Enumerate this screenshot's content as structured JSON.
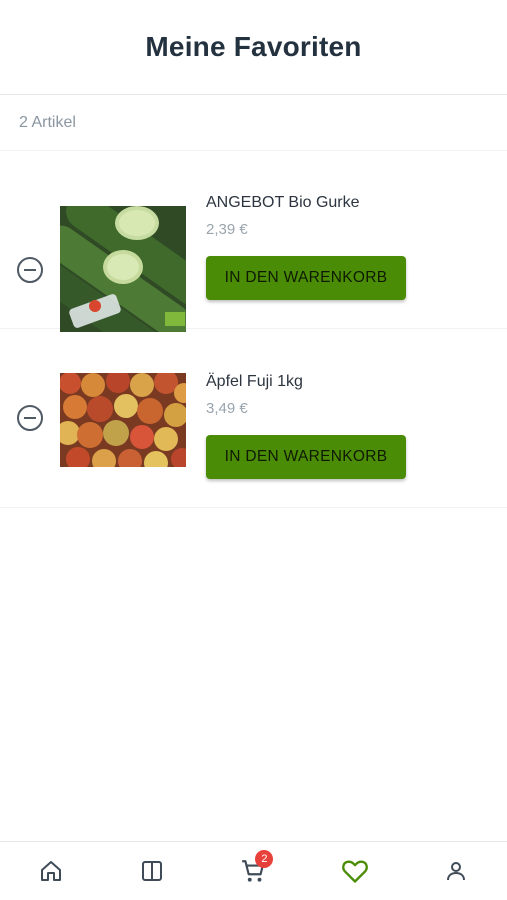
{
  "header": {
    "title": "Meine Favoriten"
  },
  "summary": {
    "count_label": "2 Artikel"
  },
  "items": [
    {
      "name": "ANGEBOT Bio Gurke",
      "price": "2,39 €",
      "add_label": "IN DEN WARENKORB",
      "image": "cucumber-photo"
    },
    {
      "name": "Äpfel Fuji 1kg",
      "price": "3,49 €",
      "add_label": "IN DEN WARENKORB",
      "image": "apples-photo"
    }
  ],
  "nav": {
    "items": [
      {
        "icon": "home-icon",
        "active": false
      },
      {
        "icon": "catalog-icon",
        "active": false
      },
      {
        "icon": "cart-icon",
        "active": false,
        "badge": "2"
      },
      {
        "icon": "heart-icon",
        "active": true
      },
      {
        "icon": "user-icon",
        "active": false
      }
    ]
  },
  "colors": {
    "accent": "#4b8c06",
    "badge": "#e8403a",
    "text": "#243240",
    "muted": "#9aa4ad"
  }
}
